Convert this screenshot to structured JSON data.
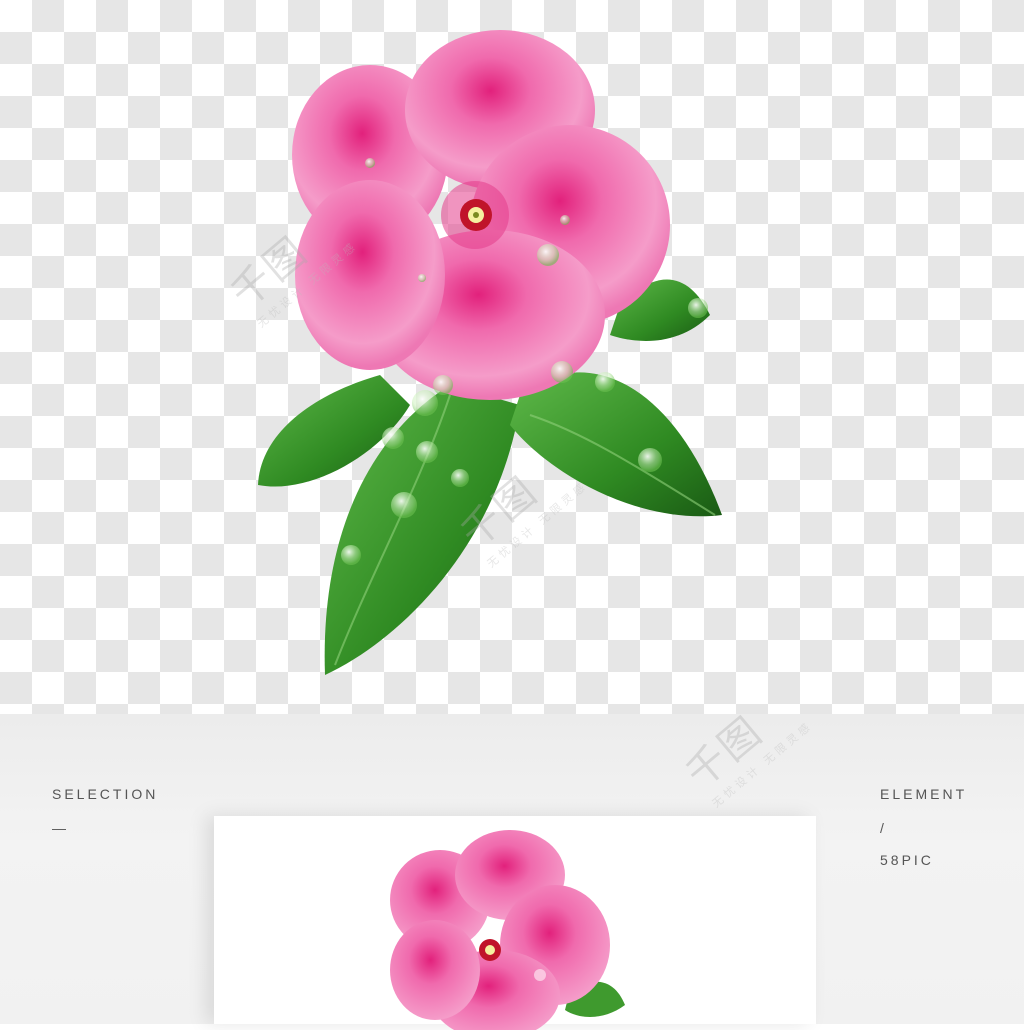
{
  "labels": {
    "selection": "SELECTION",
    "selection_dash": "—",
    "element": "ELEMENT",
    "slash": "/",
    "brand": "58PIC"
  },
  "watermark": {
    "logo_text": "千图",
    "tagline": "无忧设计 无限灵感"
  },
  "colors": {
    "petal": "#ee5fa8",
    "petal_light": "#f7a9cf",
    "leaf": "#3f9a2e",
    "leaf_dark": "#1e5e18",
    "center": "#c0142a"
  }
}
